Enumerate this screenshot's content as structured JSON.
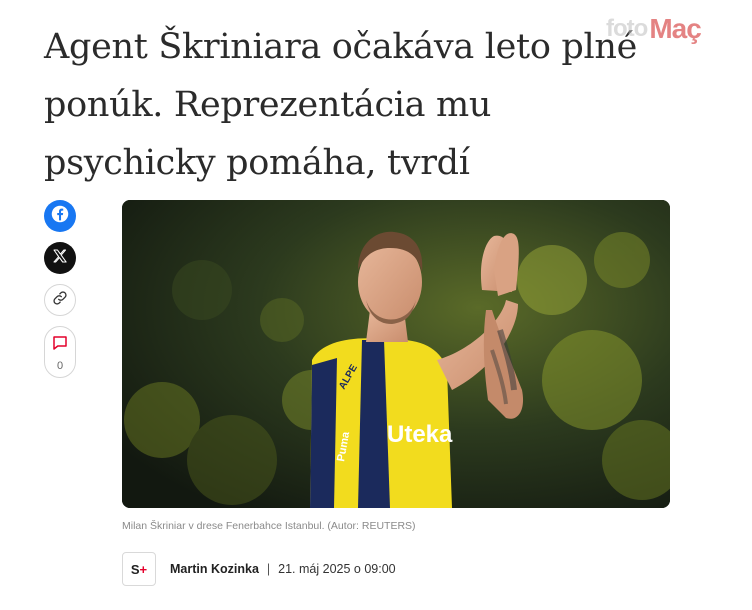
{
  "article": {
    "headline_lines": [
      "Agent Škriniara očakáva leto plné",
      "ponúk. Reprezentácia mu",
      "psychicky pomáha, tvrdí"
    ],
    "image_caption": "Milan Škriniar v drese Fenerbahce Istanbul. (Autor: REUTERS)",
    "jersey_sponsor": "Uteka",
    "jersey_brand": "Puma",
    "sleeve_sponsor": "ALPE"
  },
  "share": {
    "facebook_icon": "facebook-icon",
    "x_icon": "x-icon",
    "link_icon": "link-icon",
    "comment_icon": "comment-icon",
    "comment_count": "0"
  },
  "byline": {
    "brand_logo_text": "S",
    "brand_logo_plus": "+",
    "author": "Martin Kozinka",
    "separator": "|",
    "date": "21. máj 2025 o 09:00"
  },
  "watermark": {
    "part1": "foto",
    "part2": "Maç"
  },
  "colors": {
    "facebook": "#1877f2",
    "x": "#111111",
    "comment_accent": "#e4002b",
    "jersey_yellow": "#f2dc1e",
    "jersey_navy": "#1b2a5c"
  }
}
